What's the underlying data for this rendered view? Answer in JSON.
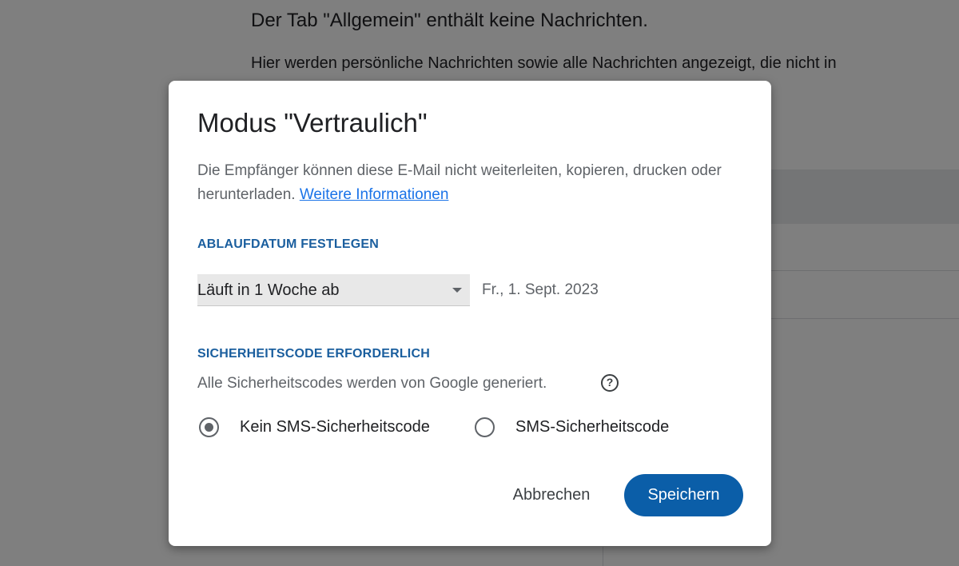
{
  "background": {
    "tab_empty_text": "Der Tab \"Allgemein\" enthält keine Nachrichten.",
    "tab_description": "Hier werden persönliche Nachrichten sowie alle Nachrichten angezeigt, die nicht in"
  },
  "dialog": {
    "title": "Modus \"Vertraulich\"",
    "description": "Die Empfänger können diese E-Mail nicht weiterleiten, kopieren, drucken oder herunterladen.",
    "learn_more_link": "Weitere Informationen",
    "expiry": {
      "heading": "ABLAUFDATUM FESTLEGEN",
      "selected_option": "Läuft in 1 Woche ab",
      "date": "Fr., 1. Sept. 2023"
    },
    "passcode": {
      "heading": "SICHERHEITSCODE ERFORDERLICH",
      "info": "Alle Sicherheitscodes werden von Google generiert.",
      "help_icon": "?",
      "options": [
        {
          "label": "Kein SMS-Sicherheitscode",
          "checked": true
        },
        {
          "label": "SMS-Sicherheitscode",
          "checked": false
        }
      ]
    },
    "buttons": {
      "cancel": "Abbrechen",
      "save": "Speichern"
    }
  },
  "colors": {
    "accent": "#0b5ea8",
    "section_heading": "#1a5e9e",
    "link": "#1a73e8",
    "scrim": "rgba(0,0,0,0.5)"
  }
}
